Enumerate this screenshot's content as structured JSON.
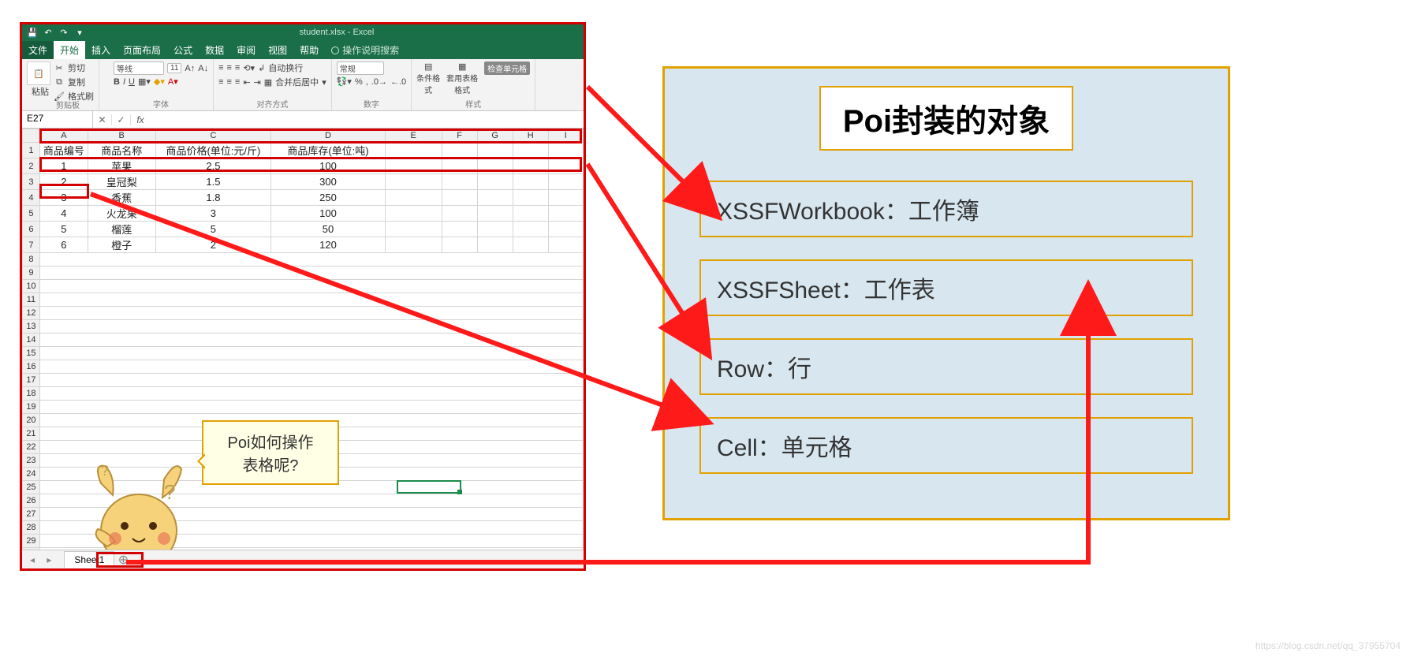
{
  "excel": {
    "title_text": "student.xlsx - Excel",
    "tabs": {
      "file": "文件",
      "home": "开始",
      "insert": "插入",
      "layout": "页面布局",
      "formula": "公式",
      "data": "数据",
      "review": "审阅",
      "view": "视图",
      "help": "帮助",
      "tellme": "操作说明搜索"
    },
    "ribbon": {
      "clipboard_label": "剪贴板",
      "paste": "粘贴",
      "cut": "剪切",
      "copy": "复制",
      "format_painter": "格式刷",
      "font_label": "字体",
      "font_name": "等线",
      "font_size": "11",
      "align_label": "对齐方式",
      "wrap": "自动换行",
      "merge": "合并后居中",
      "number_label": "数字",
      "styles_label": "样式",
      "cond": "条件格式",
      "tbl": "套用表格格式",
      "cellstyle": "检查单元格",
      "number_format": "常规"
    },
    "namebox": "E27",
    "fx": "fx",
    "columns": [
      "A",
      "B",
      "C",
      "D",
      "E",
      "F",
      "G",
      "H",
      "I"
    ],
    "headers": {
      "a": "商品编号",
      "b": "商品名称",
      "c": "商品价格(单位:元/斤)",
      "d": "商品库存(单位:吨)"
    },
    "rows": [
      {
        "a": "1",
        "b": "苹果",
        "c": "2.5",
        "d": "100"
      },
      {
        "a": "2",
        "b": "皇冠梨",
        "c": "1.5",
        "d": "300"
      },
      {
        "a": "3",
        "b": "香蕉",
        "c": "1.8",
        "d": "250"
      },
      {
        "a": "4",
        "b": "火龙果",
        "c": "3",
        "d": "100"
      },
      {
        "a": "5",
        "b": "榴莲",
        "c": "5",
        "d": "50"
      },
      {
        "a": "6",
        "b": "橙子",
        "c": "2",
        "d": "120"
      }
    ],
    "sheet_tab": "Sheet1"
  },
  "speech": {
    "line1": "Poi如何操作",
    "line2": "表格呢?"
  },
  "poi": {
    "title": "Poi封装的对象",
    "workbook": "XSSFWorkbook：工作簿",
    "sheet": "XSSFSheet：工作表",
    "row": "Row：行",
    "cell": "Cell：单元格"
  },
  "watermark": "https://blog.csdn.net/qq_37955704"
}
